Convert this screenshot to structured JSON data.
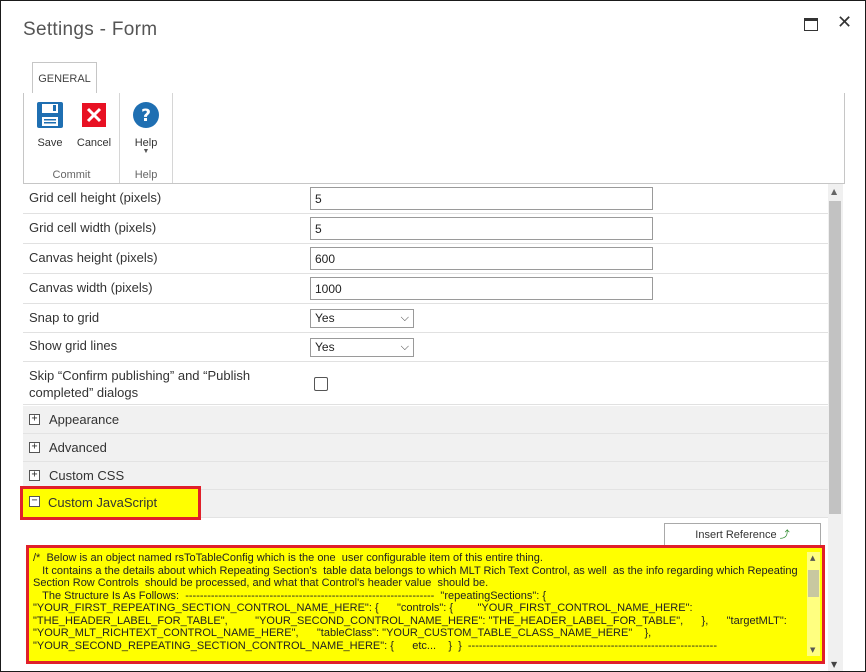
{
  "window": {
    "title": "Settings - Form"
  },
  "tabs": [
    {
      "label": "GENERAL"
    }
  ],
  "ribbon": {
    "groups": [
      {
        "label": "Commit",
        "buttons": [
          {
            "label": "Save",
            "icon": "save-icon"
          },
          {
            "label": "Cancel",
            "icon": "cancel-icon"
          }
        ]
      },
      {
        "label": "Help",
        "buttons": [
          {
            "label": "Help",
            "icon": "help-icon"
          }
        ]
      }
    ],
    "colors": {
      "save": "#1f6fb2",
      "cancel": "#e81123",
      "help": "#1f6fb2"
    }
  },
  "fields": {
    "grid_cell_height": {
      "label": "Grid cell height (pixels)",
      "value": "5"
    },
    "grid_cell_width": {
      "label": "Grid cell width (pixels)",
      "value": "5"
    },
    "canvas_height": {
      "label": "Canvas height (pixels)",
      "value": "600"
    },
    "canvas_width": {
      "label": "Canvas width (pixels)",
      "value": "1000"
    },
    "snap_to_grid": {
      "label": "Snap to grid",
      "value": "Yes"
    },
    "show_grid_lines": {
      "label": "Show grid lines",
      "value": "Yes"
    },
    "skip_dialogs": {
      "label": "Skip “Confirm publishing” and “Publish completed” dialogs",
      "checked": false
    }
  },
  "sections": [
    {
      "label": "Appearance",
      "toggle": "+"
    },
    {
      "label": "Advanced",
      "toggle": "+"
    },
    {
      "label": "Custom CSS",
      "toggle": "+"
    },
    {
      "label": "Custom JavaScript",
      "toggle": "−"
    }
  ],
  "insert_reference": {
    "label": "Insert Reference"
  },
  "custom_js": {
    "text": "/*  Below is an object named rsToTableConfig which is the one  user configurable item of this entire thing.\n   It contains a the details about which Repeating Section's  table data belongs to which MLT Rich Text Control, as well  as the info regarding which Repeating Section Row Controls  should be processed, and what that Control's header value  should be.\n   The Structure Is As Follows:  --------------------------------------------------------------------  \"repeatingSections\": {      \"YOUR_FIRST_REPEATING_SECTION_CONTROL_NAME_HERE\": {      \"controls\": {        \"YOUR_FIRST_CONTROL_NAME_HERE\": \"THE_HEADER_LABEL_FOR_TABLE\",         \"YOUR_SECOND_CONTROL_NAME_HERE\": \"THE_HEADER_LABEL_FOR_TABLE\",      },      \"targetMLT\": \"YOUR_MLT_RICHTEXT_CONTROL_NAME_HERE\",      \"tableClass\": \"YOUR_CUSTOM_TABLE_CLASS_NAME_HERE\"    },      \"YOUR_SECOND_REPEATING_SECTION_CONTROL_NAME_HERE\": {      etc...    }  }  --------------------------------------------------------------------"
  },
  "highlight_color": "#ffff00",
  "annotation_color": "#e0202a"
}
